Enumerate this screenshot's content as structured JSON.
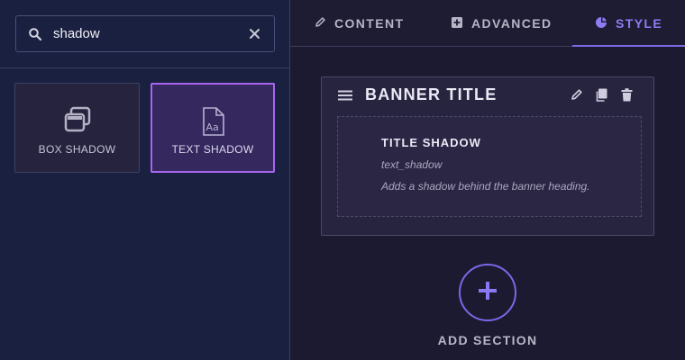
{
  "search": {
    "value": "shadow",
    "icon": "search-icon",
    "clear_icon": "close-icon"
  },
  "widgets": [
    {
      "label": "BOX SHADOW",
      "icon": "box-shadow-icon",
      "selected": false
    },
    {
      "label": "TEXT SHADOW",
      "icon": "text-shadow-icon",
      "selected": true
    }
  ],
  "tabs": [
    {
      "label": "CONTENT",
      "icon": "pencil-icon",
      "active": false
    },
    {
      "label": "ADVANCED",
      "icon": "plus-square-icon",
      "active": false
    },
    {
      "label": "STYLE",
      "icon": "palette-icon",
      "active": true
    }
  ],
  "section": {
    "title": "BANNER TITLE",
    "field": {
      "title": "TITLE SHADOW",
      "key": "text_shadow",
      "description": "Adds a shadow behind the banner heading."
    }
  },
  "add_section": {
    "label": "ADD SECTION"
  },
  "colors": {
    "accent": "#7a68e6",
    "selected_border": "#a866f0",
    "left_bg": "#1a2040",
    "right_bg": "#1c1a30"
  }
}
